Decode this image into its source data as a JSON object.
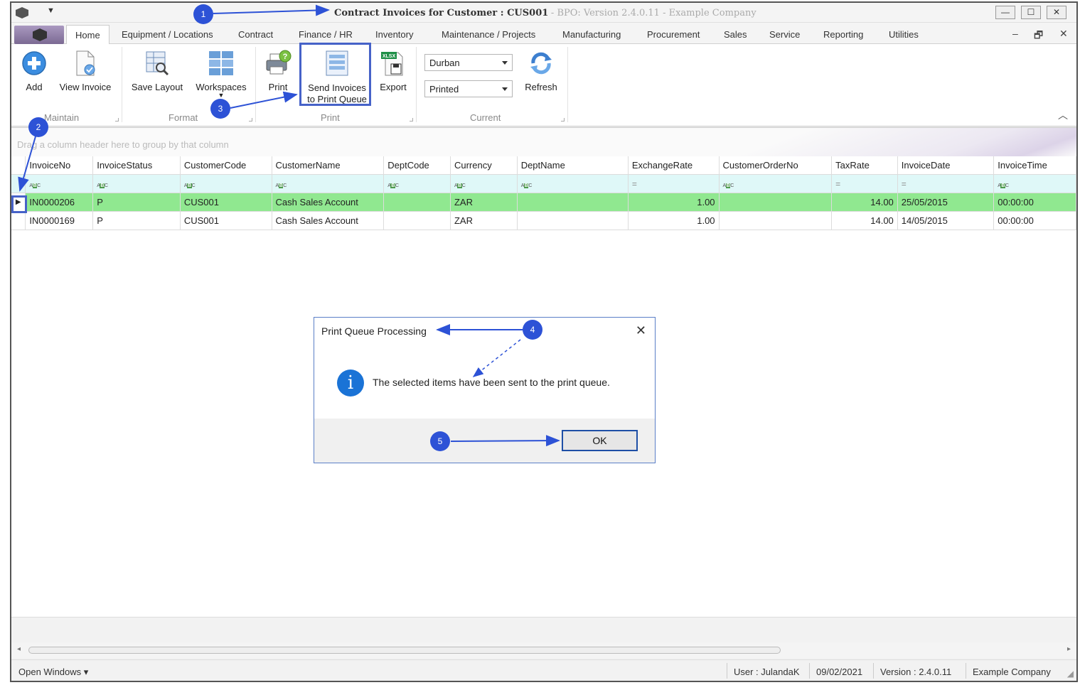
{
  "window": {
    "title_main": "Contract Invoices for Customer : CUS001",
    "title_sub": "- BPO: Version 2.4.0.11 - Example Company",
    "controls": {
      "minimize": "—",
      "maximize": "☐",
      "close": "✕"
    }
  },
  "tabs": [
    {
      "label": "Home",
      "active": true
    },
    {
      "label": "Equipment / Locations"
    },
    {
      "label": "Contract"
    },
    {
      "label": "Finance / HR"
    },
    {
      "label": "Inventory"
    },
    {
      "label": "Maintenance / Projects"
    },
    {
      "label": "Manufacturing"
    },
    {
      "label": "Procurement"
    },
    {
      "label": "Sales"
    },
    {
      "label": "Service"
    },
    {
      "label": "Reporting"
    },
    {
      "label": "Utilities"
    }
  ],
  "mdi_controls": {
    "minimize": "–",
    "restore": "🗗",
    "close": "✕"
  },
  "ribbon": {
    "maintain": {
      "label": "Maintain",
      "add": "Add",
      "view_invoice": "View Invoice"
    },
    "format": {
      "label": "Format",
      "save_layout": "Save Layout",
      "workspaces": "Workspaces"
    },
    "print": {
      "label": "Print",
      "print": "Print",
      "send_line1": "Send Invoices",
      "send_line2": "to Print Queue",
      "export": "Export",
      "export_badge": "XLSX"
    },
    "current": {
      "label": "Current",
      "site_value": "Durban",
      "status_value": "Printed",
      "refresh": "Refresh"
    }
  },
  "grid": {
    "group_hint": "Drag a column header here to group by that column",
    "columns": [
      "InvoiceNo",
      "InvoiceStatus",
      "CustomerCode",
      "CustomerName",
      "DeptCode",
      "Currency",
      "DeptName",
      "ExchangeRate",
      "CustomerOrderNo",
      "TaxRate",
      "InvoiceDate",
      "InvoiceTime"
    ],
    "rows": [
      [
        "IN0000206",
        "P",
        "CUS001",
        "Cash Sales Account",
        "",
        "ZAR",
        "",
        "1.00",
        "",
        "14.00",
        "25/05/2015",
        "00:00:00"
      ],
      [
        "IN0000169",
        "P",
        "CUS001",
        "Cash Sales Account",
        "",
        "ZAR",
        "",
        "1.00",
        "",
        "14.00",
        "14/05/2015",
        "00:00:00"
      ]
    ],
    "selected_row_color": "#90e890"
  },
  "dialog": {
    "title": "Print Queue Processing",
    "close": "✕",
    "icon": "info-icon",
    "message": "The selected items have been sent to the print queue.",
    "ok": "OK"
  },
  "statusbar": {
    "open_windows": "Open Windows ▾",
    "user": "User : JulandaK",
    "date": "09/02/2021",
    "version": "Version : 2.4.0.11",
    "company": "Example Company"
  },
  "callouts": [
    "1",
    "2",
    "3",
    "4",
    "5"
  ],
  "accent_color": "#2d52d6"
}
